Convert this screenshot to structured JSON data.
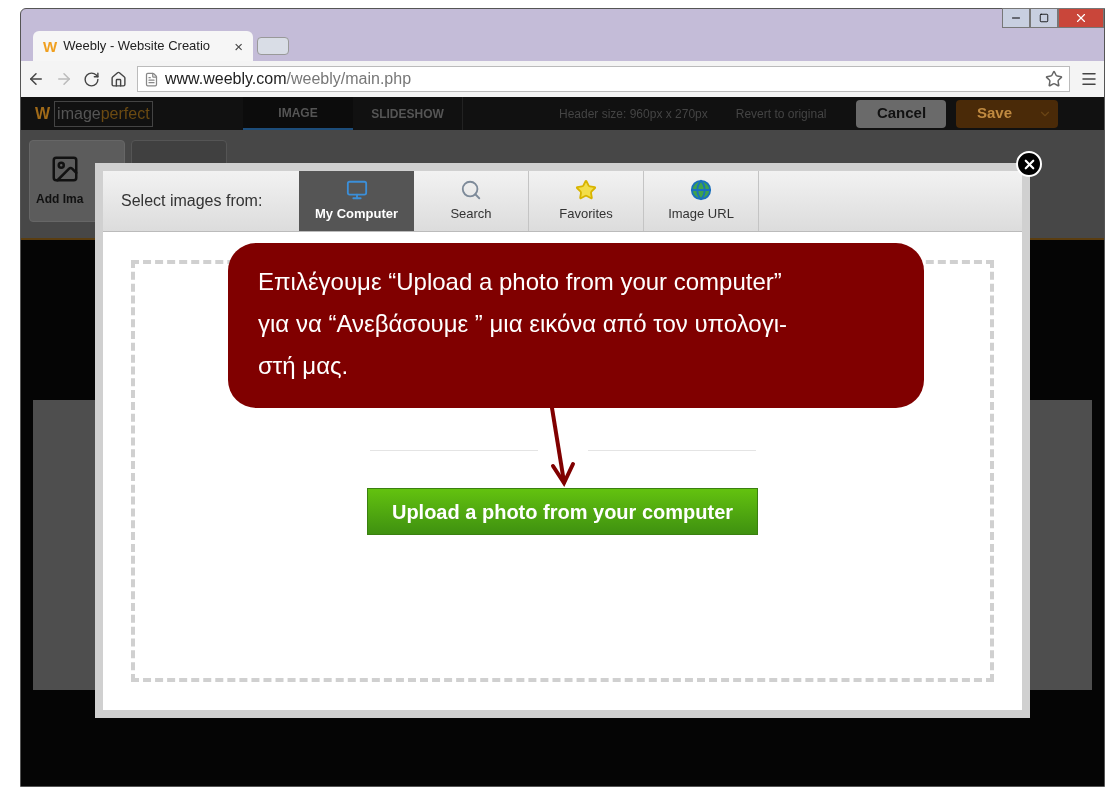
{
  "browser": {
    "tab": {
      "favicon": "W",
      "title": "Weebly - Website Creatio",
      "close": "×"
    },
    "address": {
      "domain": "www.weebly.com",
      "path": "/weebly/main.php"
    }
  },
  "editor": {
    "logo": {
      "mark": "W",
      "prefix": "image",
      "suffix": "perfect"
    },
    "tabs": [
      {
        "label": "IMAGE",
        "selected": true
      },
      {
        "label": "SLIDESHOW",
        "selected": false
      }
    ],
    "header_size": "Header size: 960px x 270px",
    "revert": "Revert to original",
    "cancel": "Cancel",
    "save": "Save",
    "tool": "Add Ima"
  },
  "dialog": {
    "source_label": "Select images from:",
    "sources": [
      {
        "label": "My Computer",
        "kind": "monitor",
        "selected": true
      },
      {
        "label": "Search",
        "kind": "search",
        "selected": false
      },
      {
        "label": "Favorites",
        "kind": "star",
        "selected": false
      },
      {
        "label": "Image URL",
        "kind": "globe",
        "selected": false
      }
    ],
    "upload_button": "Upload a photo from your computer"
  },
  "callout": {
    "lines": [
      "Επιλέγουμε “Upload a photo from your computer”",
      "για να “Ανεβάσουμε ” μια εικόνα από τον υπολογι-",
      "στή μας."
    ]
  }
}
